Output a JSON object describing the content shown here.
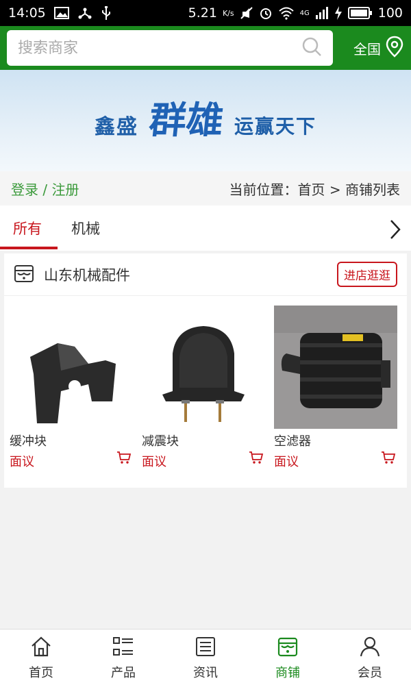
{
  "status": {
    "time": "14:05",
    "speed": "5.21",
    "speed_unit": "K/s",
    "network": "4G",
    "battery": "100"
  },
  "header": {
    "search_placeholder": "搜索商家",
    "region": "全国"
  },
  "banner": {
    "left_text": "鑫盛",
    "big_text": "群雄",
    "right_text": "运赢天下"
  },
  "breadcrumb": {
    "login": "登录 / 注册",
    "location": "当前位置：首页 > 商铺列表"
  },
  "tabs": [
    {
      "label": "所有"
    },
    {
      "label": "机械"
    }
  ],
  "shop": {
    "name": "山东机械配件",
    "visit_label": "进店逛逛",
    "products": [
      {
        "name": "缓冲块",
        "price": "面议"
      },
      {
        "name": "减震块",
        "price": "面议"
      },
      {
        "name": "空滤器",
        "price": "面议"
      }
    ]
  },
  "bottom_nav": [
    {
      "label": "首页",
      "icon": "home-icon"
    },
    {
      "label": "产品",
      "icon": "list-icon"
    },
    {
      "label": "资讯",
      "icon": "news-icon"
    },
    {
      "label": "商铺",
      "icon": "shop-icon"
    },
    {
      "label": "会员",
      "icon": "user-icon"
    }
  ],
  "colors": {
    "brand_green": "#1b8a1e",
    "accent_red": "#c8161d"
  }
}
